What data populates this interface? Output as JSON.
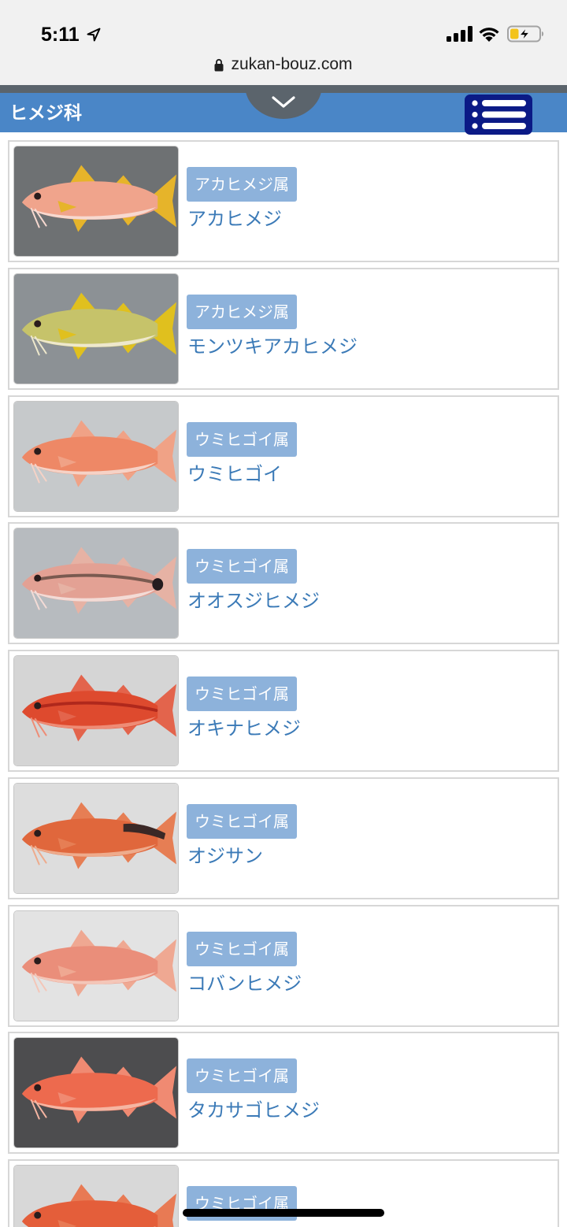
{
  "status_bar": {
    "time": "5:11",
    "signal_bars": 4,
    "battery_level": 0.3,
    "icons": [
      "location-arrow-icon",
      "signal-icon",
      "wifi-icon",
      "battery-charging-icon"
    ]
  },
  "browser": {
    "url": "zukan-bouz.com",
    "secure_icon": "lock-icon"
  },
  "header": {
    "title": "ヒメジ科",
    "dropdown_icon": "chevron-down-icon",
    "menu_icon": "list-menu-icon"
  },
  "theme": {
    "topbar": "#f1f1f1",
    "strip": "#5b646c",
    "bar": "#4a86c7",
    "menu": "#0b1a86",
    "badge": "#8db2db",
    "link": "#3b7ab7",
    "card_border": "#d7d7d7"
  },
  "items": [
    {
      "genus": "アカヒメジ属",
      "name": "アカヒメジ",
      "photo": {
        "bg": "#6e7173",
        "body": "#f0a48c",
        "belly": "#f7d9d0",
        "fin": "#e6b42a"
      }
    },
    {
      "genus": "アカヒメジ属",
      "name": "モンツキアカヒメジ",
      "photo": {
        "bg": "#8c9195",
        "body": "#c6c36a",
        "belly": "#eee8cc",
        "fin": "#e0c01e"
      }
    },
    {
      "genus": "ウミヒゴイ属",
      "name": "ウミヒゴイ",
      "photo": {
        "bg": "#c6c9cb",
        "body": "#ee8866",
        "belly": "#f6d2c6",
        "fin": "#f0a286"
      }
    },
    {
      "genus": "ウミヒゴイ属",
      "name": "オオスジヒメジ",
      "photo": {
        "bg": "#b7bbbf",
        "body": "#e3a194",
        "belly": "#f3dbd6",
        "fin": "#e6b2a4",
        "stripe": "#7a5a50",
        "tail_spot": "#241c1e"
      }
    },
    {
      "genus": "ウミヒゴイ属",
      "name": "オキナヒメジ",
      "photo": {
        "bg": "#d5d5d5",
        "body": "#de4a2e",
        "belly": "#ee8c76",
        "fin": "#e3644c",
        "stripe": "#b0281c"
      }
    },
    {
      "genus": "ウミヒゴイ属",
      "name": "オジサン",
      "photo": {
        "bg": "#dddddd",
        "body": "#e0673c",
        "belly": "#eeab8c",
        "fin": "#e67e54",
        "saddle": "#3a2826"
      }
    },
    {
      "genus": "ウミヒゴイ属",
      "name": "コバンヒメジ",
      "photo": {
        "bg": "#e3e3e3",
        "body": "#ea8e7a",
        "belly": "#f4c6b8",
        "fin": "#efa892"
      }
    },
    {
      "genus": "ウミヒゴイ属",
      "name": "タカサゴヒメジ",
      "photo": {
        "bg": "#4d4d4f",
        "body": "#ed6a4e",
        "belly": "#f5b5a2",
        "fin": "#f08a72"
      }
    },
    {
      "genus": "ウミヒゴイ属",
      "photo": {
        "bg": "#d8d8d8",
        "body": "#e45e3a",
        "belly": "#f0a88a",
        "fin": "#e87a54"
      }
    }
  ]
}
